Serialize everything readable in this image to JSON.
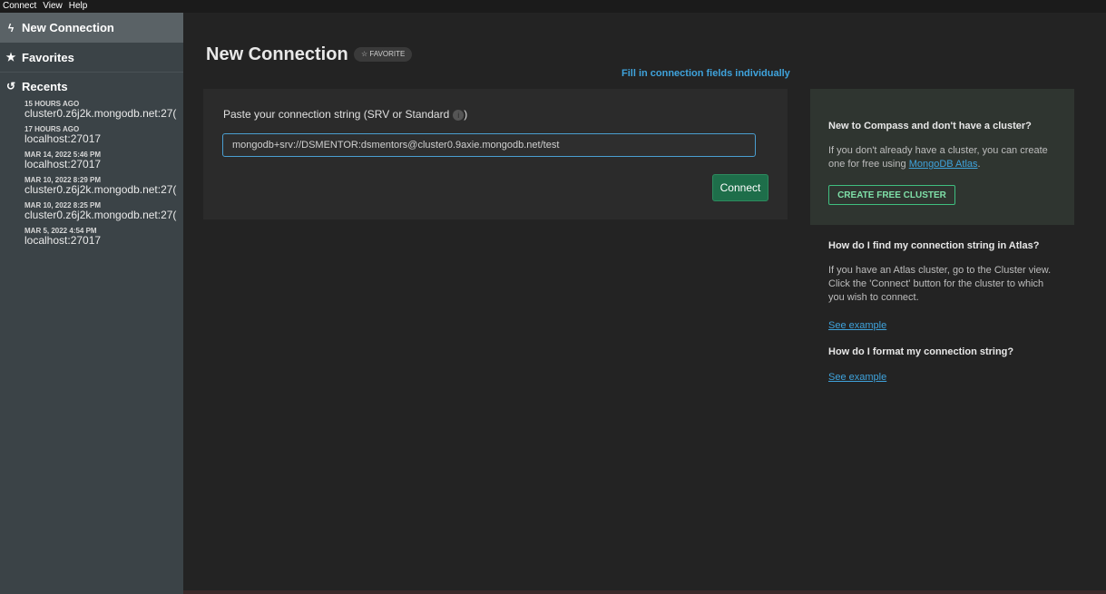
{
  "menubar": {
    "items": [
      "Connect",
      "View",
      "Help"
    ]
  },
  "sidebar": {
    "new_connection": "New Connection",
    "favorites": "Favorites",
    "recents": "Recents",
    "recent_items": [
      {
        "time": "15 HOURS AGO",
        "host": "cluster0.z6j2k.mongodb.net:27("
      },
      {
        "time": "17 HOURS AGO",
        "host": "localhost:27017"
      },
      {
        "time": "MAR 14, 2022 5:46 PM",
        "host": "localhost:27017"
      },
      {
        "time": "MAR 10, 2022 8:29 PM",
        "host": "cluster0.z6j2k.mongodb.net:27("
      },
      {
        "time": "MAR 10, 2022 8:25 PM",
        "host": "cluster0.z6j2k.mongodb.net:27("
      },
      {
        "time": "MAR 5, 2022 4:54 PM",
        "host": "localhost:27017"
      }
    ]
  },
  "main": {
    "title": "New Connection",
    "favorite_badge": "☆ FAVORITE",
    "fill_link": "Fill in connection fields individually",
    "conn_label": "Paste your connection string (SRV or Standard",
    "conn_label_end": ")",
    "conn_value": "mongodb+srv://DSMENTOR:dsmentors@cluster0.9axie.mongodb.net/test",
    "connect_button": "Connect"
  },
  "help": {
    "new_heading": "New to Compass and don't have a cluster?",
    "new_text_1": "If you don't already have a cluster, you can create one for free using",
    "atlas_link": "MongoDB Atlas",
    "new_text_2": ".",
    "create_button": "CREATE FREE CLUSTER",
    "find_heading": "How do I find my connection string in Atlas?",
    "find_text": "If you have an Atlas cluster, go to the Cluster view. Click the 'Connect' button for the cluster to which you wish to connect.",
    "see_example_1": "See example",
    "format_heading": "How do I format my connection string?",
    "see_example_2": "See example"
  },
  "colors": {
    "accent_link": "#3fa3dc",
    "connect_green": "#1e6e4a",
    "cluster_green": "#3fbf7f"
  },
  "icons": {
    "new_connection": "lightning-icon",
    "favorites": "star-icon",
    "recents": "history-icon",
    "info": "info-icon"
  }
}
